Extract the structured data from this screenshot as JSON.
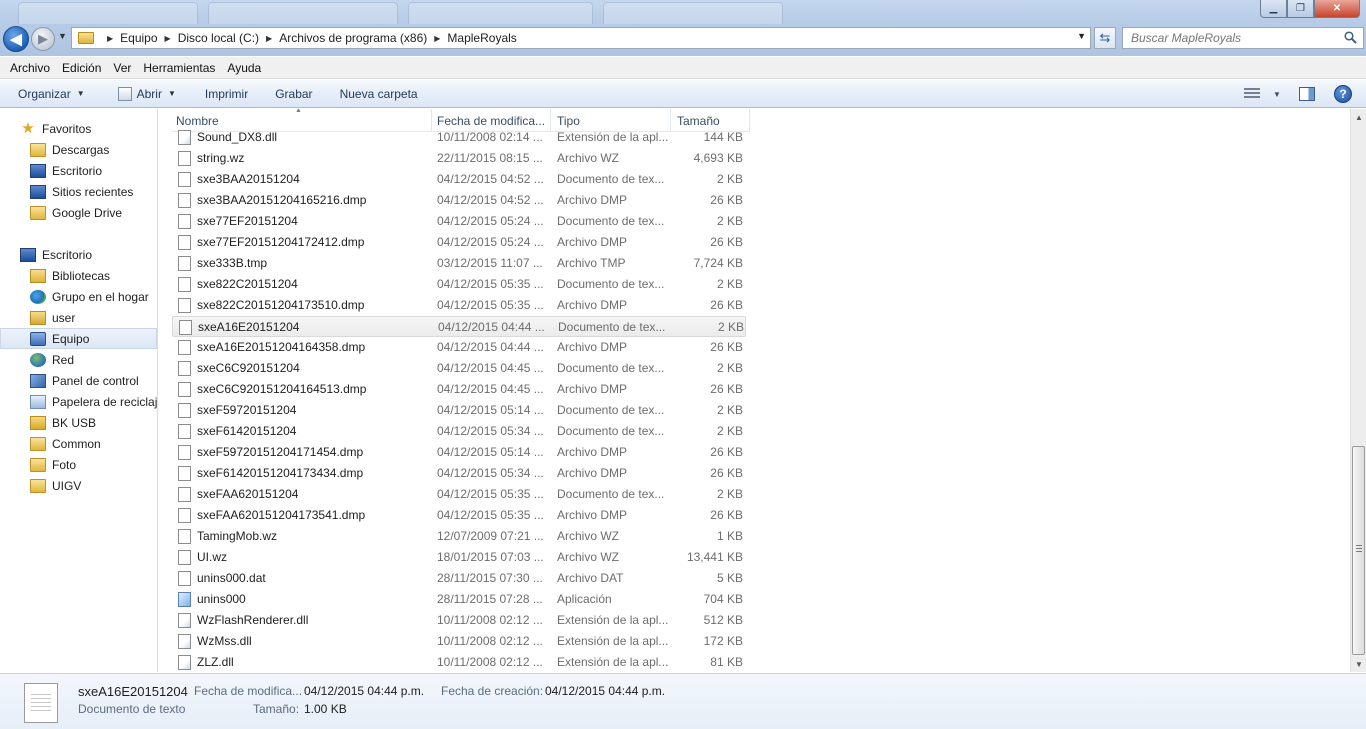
{
  "window": {
    "controls": {
      "minimize": "▁",
      "maximize": "❐",
      "close": "✕"
    }
  },
  "address": {
    "crumbs": [
      "Equipo",
      "Disco local (C:)",
      "Archivos de programa (x86)",
      "MapleRoyals"
    ]
  },
  "search": {
    "placeholder": "Buscar MapleRoyals"
  },
  "menubar": {
    "items": [
      "Archivo",
      "Edición",
      "Ver",
      "Herramientas",
      "Ayuda"
    ]
  },
  "commandbar": {
    "organize": "Organizar",
    "open": "Abrir",
    "print": "Imprimir",
    "burn": "Grabar",
    "new_folder": "Nueva carpeta"
  },
  "navpane": {
    "items": [
      {
        "label": "Favoritos",
        "icon": "star-icon"
      },
      {
        "label": "Descargas",
        "icon": "downloads-folder-icon"
      },
      {
        "label": "Escritorio",
        "icon": "desktop-icon"
      },
      {
        "label": "Sitios recientes",
        "icon": "recent-places-icon"
      },
      {
        "label": "Google Drive",
        "icon": "google-drive-folder-icon"
      },
      {
        "label": "Escritorio",
        "icon": "desktop-icon"
      },
      {
        "label": "Bibliotecas",
        "icon": "libraries-icon"
      },
      {
        "label": "Grupo en el hogar",
        "icon": "homegroup-icon"
      },
      {
        "label": "user",
        "icon": "user-folder-icon"
      },
      {
        "label": "Equipo",
        "icon": "computer-icon",
        "selected": true
      },
      {
        "label": "Red",
        "icon": "network-icon"
      },
      {
        "label": "Panel de control",
        "icon": "control-panel-icon"
      },
      {
        "label": "Papelera de reciclaje",
        "icon": "recycle-bin-icon"
      },
      {
        "label": "BK USB",
        "icon": "folder-icon"
      },
      {
        "label": "Common",
        "icon": "folder-icon"
      },
      {
        "label": "Foto",
        "icon": "folder-icon"
      },
      {
        "label": "UIGV",
        "icon": "folder-icon"
      }
    ]
  },
  "filelist": {
    "columns": {
      "name": "Nombre",
      "date": "Fecha de modifica...",
      "type": "Tipo",
      "size": "Tamaño"
    },
    "rows": [
      {
        "name": "Sound_DX8.dll",
        "date": "10/11/2008 02:14 ...",
        "type": "Extensión de la apl...",
        "size": "144 KB",
        "kind": "dll"
      },
      {
        "name": "string.wz",
        "date": "22/11/2015 08:15 ...",
        "type": "Archivo WZ",
        "size": "4,693 KB",
        "kind": "file"
      },
      {
        "name": "sxe3BAA20151204",
        "date": "04/12/2015 04:52 ...",
        "type": "Documento de tex...",
        "size": "2 KB",
        "kind": "file"
      },
      {
        "name": "sxe3BAA20151204165216.dmp",
        "date": "04/12/2015 04:52 ...",
        "type": "Archivo DMP",
        "size": "26 KB",
        "kind": "file"
      },
      {
        "name": "sxe77EF20151204",
        "date": "04/12/2015 05:24 ...",
        "type": "Documento de tex...",
        "size": "2 KB",
        "kind": "file"
      },
      {
        "name": "sxe77EF20151204172412.dmp",
        "date": "04/12/2015 05:24 ...",
        "type": "Archivo DMP",
        "size": "26 KB",
        "kind": "file"
      },
      {
        "name": "sxe333B.tmp",
        "date": "03/12/2015 11:07 ...",
        "type": "Archivo TMP",
        "size": "7,724 KB",
        "kind": "file"
      },
      {
        "name": "sxe822C20151204",
        "date": "04/12/2015 05:35 ...",
        "type": "Documento de tex...",
        "size": "2 KB",
        "kind": "file"
      },
      {
        "name": "sxe822C20151204173510.dmp",
        "date": "04/12/2015 05:35 ...",
        "type": "Archivo DMP",
        "size": "26 KB",
        "kind": "file"
      },
      {
        "name": "sxeA16E20151204",
        "date": "04/12/2015 04:44 ...",
        "type": "Documento de tex...",
        "size": "2 KB",
        "kind": "file",
        "selected": true
      },
      {
        "name": "sxeA16E20151204164358.dmp",
        "date": "04/12/2015 04:44 ...",
        "type": "Archivo DMP",
        "size": "26 KB",
        "kind": "file"
      },
      {
        "name": "sxeC6C920151204",
        "date": "04/12/2015 04:45 ...",
        "type": "Documento de tex...",
        "size": "2 KB",
        "kind": "file"
      },
      {
        "name": "sxeC6C920151204164513.dmp",
        "date": "04/12/2015 04:45 ...",
        "type": "Archivo DMP",
        "size": "26 KB",
        "kind": "file"
      },
      {
        "name": "sxeF59720151204",
        "date": "04/12/2015 05:14 ...",
        "type": "Documento de tex...",
        "size": "2 KB",
        "kind": "file"
      },
      {
        "name": "sxeF61420151204",
        "date": "04/12/2015 05:34 ...",
        "type": "Documento de tex...",
        "size": "2 KB",
        "kind": "file"
      },
      {
        "name": "sxeF59720151204171454.dmp",
        "date": "04/12/2015 05:14 ...",
        "type": "Archivo DMP",
        "size": "26 KB",
        "kind": "file"
      },
      {
        "name": "sxeF61420151204173434.dmp",
        "date": "04/12/2015 05:34 ...",
        "type": "Archivo DMP",
        "size": "26 KB",
        "kind": "file"
      },
      {
        "name": "sxeFAA620151204",
        "date": "04/12/2015 05:35 ...",
        "type": "Documento de tex...",
        "size": "2 KB",
        "kind": "file"
      },
      {
        "name": "sxeFAA620151204173541.dmp",
        "date": "04/12/2015 05:35 ...",
        "type": "Archivo DMP",
        "size": "26 KB",
        "kind": "file"
      },
      {
        "name": "TamingMob.wz",
        "date": "12/07/2009 07:21 ...",
        "type": "Archivo WZ",
        "size": "1 KB",
        "kind": "file"
      },
      {
        "name": "UI.wz",
        "date": "18/01/2015 07:03 ...",
        "type": "Archivo WZ",
        "size": "13,441 KB",
        "kind": "file"
      },
      {
        "name": "unins000.dat",
        "date": "28/11/2015 07:30 ...",
        "type": "Archivo DAT",
        "size": "5 KB",
        "kind": "file"
      },
      {
        "name": "unins000",
        "date": "28/11/2015 07:28 ...",
        "type": "Aplicación",
        "size": "704 KB",
        "kind": "app"
      },
      {
        "name": "WzFlashRenderer.dll",
        "date": "10/11/2008 02:12 ...",
        "type": "Extensión de la apl...",
        "size": "512 KB",
        "kind": "dll"
      },
      {
        "name": "WzMss.dll",
        "date": "10/11/2008 02:12 ...",
        "type": "Extensión de la apl...",
        "size": "172 KB",
        "kind": "dll"
      },
      {
        "name": "ZLZ.dll",
        "date": "10/11/2008 02:12 ...",
        "type": "Extensión de la apl...",
        "size": "81 KB",
        "kind": "dll"
      }
    ]
  },
  "details": {
    "name": "sxeA16E20151204",
    "type": "Documento de texto",
    "modified_label": "Fecha de modifica...",
    "modified_value": "04/12/2015 04:44 p.m.",
    "created_label": "Fecha de creación:",
    "created_value": "04/12/2015 04:44 p.m.",
    "size_label": "Tamaño:",
    "size_value": "1.00 KB"
  }
}
